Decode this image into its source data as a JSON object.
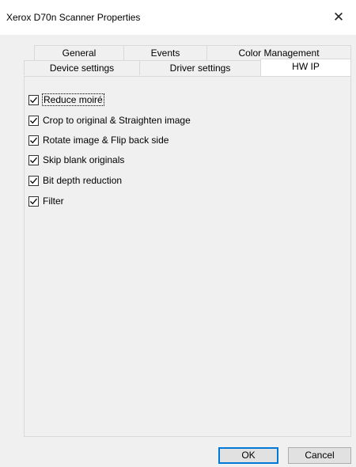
{
  "window": {
    "title": "Xerox  D70n Scanner Properties",
    "close_glyph": "✕"
  },
  "tabs": {
    "row1": [
      {
        "label": "General"
      },
      {
        "label": "Events"
      },
      {
        "label": "Color Management"
      }
    ],
    "row2": [
      {
        "label": "Device settings"
      },
      {
        "label": "Driver settings"
      },
      {
        "label": "HW IP",
        "selected": true
      }
    ]
  },
  "options": [
    {
      "label": "Reduce moiré",
      "checked": true,
      "focused": true
    },
    {
      "label": "Crop to original & Straighten image",
      "checked": true
    },
    {
      "label": "Rotate image & Flip back side",
      "checked": true
    },
    {
      "label": "Skip blank originals",
      "checked": true
    },
    {
      "label": "Bit depth reduction",
      "checked": true
    },
    {
      "label": "Filter",
      "checked": true
    }
  ],
  "buttons": {
    "ok": "OK",
    "cancel": "Cancel"
  },
  "icons": {
    "close": "close-icon",
    "check": "checkmark-icon"
  }
}
